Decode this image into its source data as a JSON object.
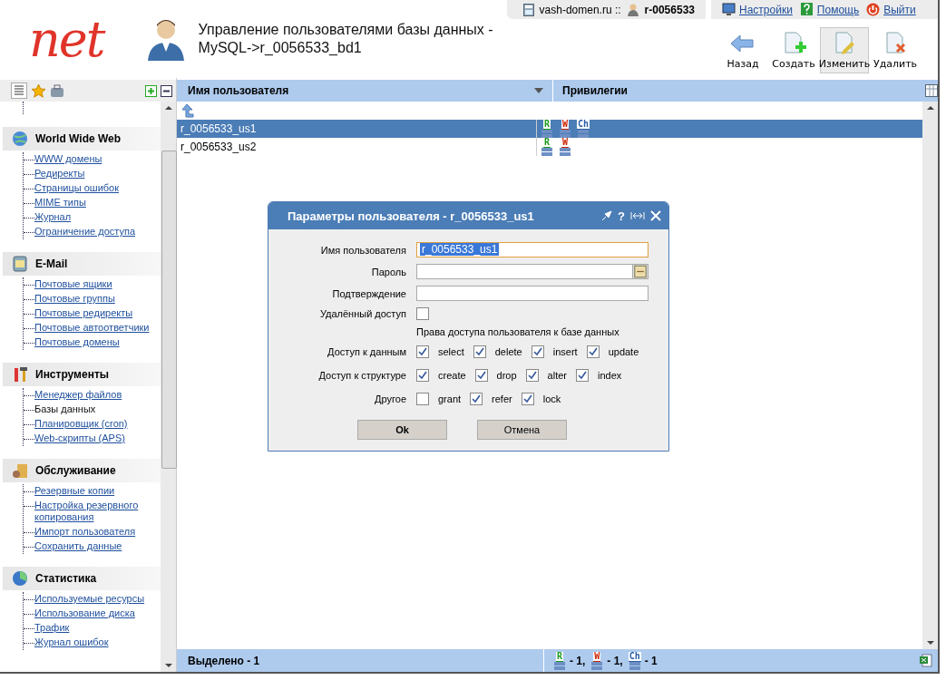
{
  "logo": {
    "text": "net"
  },
  "account": {
    "domain": "vash-domen.ru ::",
    "user": "r-0056533"
  },
  "top_links": [
    {
      "label": "Настройки",
      "kind": "settings"
    },
    {
      "label": "Помощь",
      "kind": "help"
    },
    {
      "label": "Выйти",
      "kind": "logout"
    }
  ],
  "page_title": "Управление пользователями базы данных - MySQL->r_0056533_bd1",
  "toolbar": [
    {
      "label": "Назад",
      "kind": "back",
      "selected": false
    },
    {
      "label": "Создать",
      "kind": "create",
      "selected": false
    },
    {
      "label": "Изменить",
      "kind": "edit",
      "selected": true
    },
    {
      "label": "Удалить",
      "kind": "delete",
      "selected": false
    }
  ],
  "sidebar": {
    "sections": [
      {
        "title": "World Wide Web",
        "kind": "web",
        "items": [
          {
            "label": "WWW домены",
            "selected": false
          },
          {
            "label": "Редиректы",
            "selected": false
          },
          {
            "label": "Страницы ошибок",
            "selected": false
          },
          {
            "label": "MIME типы",
            "selected": false
          },
          {
            "label": "Журнал",
            "selected": false
          },
          {
            "label": "Ограничение доступа",
            "selected": false
          }
        ]
      },
      {
        "title": "E-Mail",
        "kind": "mail",
        "items": [
          {
            "label": "Почтовые ящики",
            "selected": false
          },
          {
            "label": "Почтовые группы",
            "selected": false
          },
          {
            "label": "Почтовые редиректы",
            "selected": false
          },
          {
            "label": "Почтовые автоответчики",
            "selected": false
          },
          {
            "label": "Почтовые домены",
            "selected": false
          }
        ]
      },
      {
        "title": "Инструменты",
        "kind": "tools",
        "items": [
          {
            "label": "Менеджер файлов",
            "selected": false
          },
          {
            "label": "Базы данных",
            "selected": true
          },
          {
            "label": "Планировщик (cron)",
            "selected": false
          },
          {
            "label": "Web-скрипты (APS)",
            "selected": false
          }
        ]
      },
      {
        "title": "Обслуживание",
        "kind": "service",
        "items": [
          {
            "label": "Резервные копии",
            "selected": false
          },
          {
            "label": "Настройка резервного копирования",
            "selected": false
          },
          {
            "label": "Импорт пользователя",
            "selected": false
          },
          {
            "label": "Сохранить данные",
            "selected": false
          }
        ]
      },
      {
        "title": "Статистика",
        "kind": "stats",
        "items": [
          {
            "label": "Используемые ресурсы",
            "selected": false
          },
          {
            "label": "Использование диска",
            "selected": false
          },
          {
            "label": "Трафик",
            "selected": false
          },
          {
            "label": "Журнал ошибок",
            "selected": false
          }
        ]
      }
    ]
  },
  "table": {
    "columns": [
      "Имя пользователя",
      "Привилегии"
    ],
    "rows": [
      {
        "name": "r_0056533_us1",
        "selected": true,
        "privileges": [
          {
            "letter": "R",
            "color": "#1a9a1a"
          },
          {
            "letter": "W",
            "color": "#cc2200"
          },
          {
            "letter": "Ch",
            "color": "#2a5fa8"
          }
        ]
      },
      {
        "name": "r_0056533_us2",
        "selected": false,
        "privileges": [
          {
            "letter": "R",
            "color": "#1a9a1a"
          },
          {
            "letter": "W",
            "color": "#cc2200"
          }
        ]
      }
    ]
  },
  "status_bar": {
    "selected": "Выделено - 1",
    "counts": [
      {
        "letter": "R",
        "color": "#1a9a1a",
        "text": "- 1,"
      },
      {
        "letter": "W",
        "color": "#cc2200",
        "text": "- 1,"
      },
      {
        "letter": "Ch",
        "color": "#2a5fa8",
        "text": "- 1"
      }
    ]
  },
  "dialog": {
    "title": "Параметры пользователя - r_0056533_us1",
    "help_button": "?",
    "fields": [
      {
        "label": "Имя пользователя",
        "value": "r_0056533_us1",
        "kind": "text"
      },
      {
        "label": "Пароль",
        "kind": "password"
      },
      {
        "label": "Подтверждение",
        "kind": "confirm"
      }
    ],
    "remote": {
      "label": "Удалённый доступ",
      "checked": false
    },
    "rights_heading": "Права доступа пользователя к базе данных",
    "groups": [
      {
        "label": "Доступ к данным",
        "options": [
          {
            "label": "select",
            "checked": true
          },
          {
            "label": "delete",
            "checked": true
          },
          {
            "label": "insert",
            "checked": true
          },
          {
            "label": "update",
            "checked": true
          }
        ]
      },
      {
        "label": "Доступ к структуре",
        "options": [
          {
            "label": "create",
            "checked": true
          },
          {
            "label": "drop",
            "checked": true
          },
          {
            "label": "alter",
            "checked": true
          },
          {
            "label": "index",
            "checked": true
          }
        ]
      },
      {
        "label": "Другое",
        "options": [
          {
            "label": "grant",
            "checked": false
          },
          {
            "label": "refer",
            "checked": true
          },
          {
            "label": "lock",
            "checked": true
          }
        ]
      }
    ],
    "buttons": [
      "Ok",
      "Отмена"
    ]
  }
}
